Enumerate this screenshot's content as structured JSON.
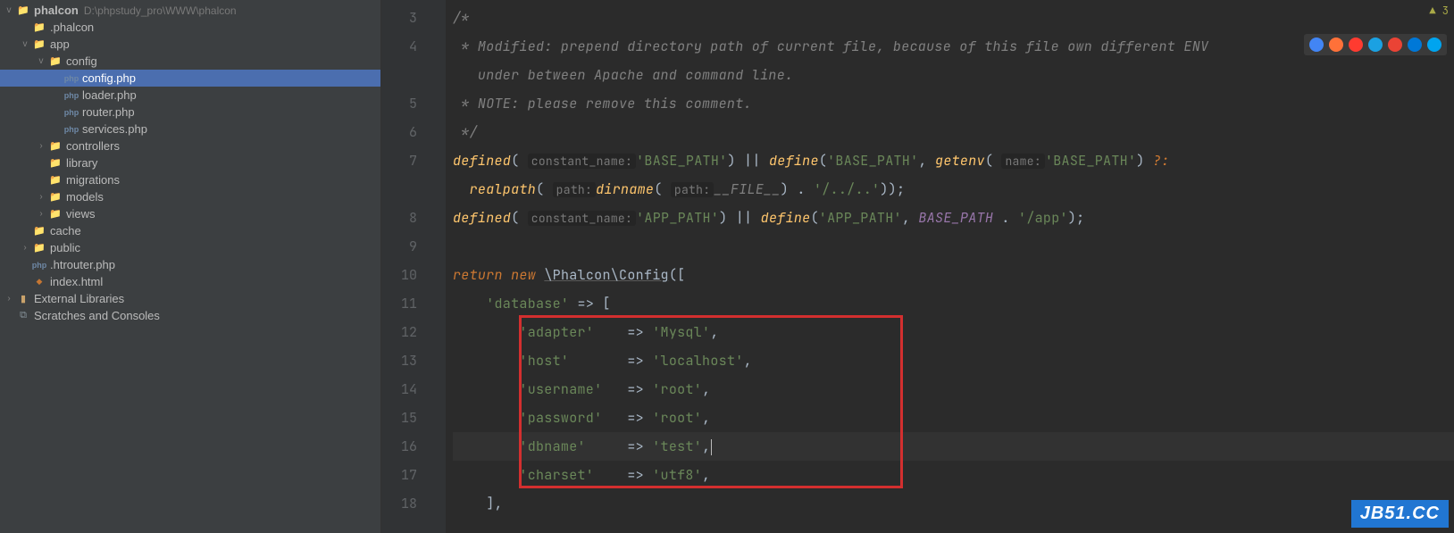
{
  "sidebar": {
    "project": {
      "name": "phalcon",
      "path": "D:\\phpstudy_pro\\WWW\\phalcon"
    },
    "items": [
      {
        "label": ".phalcon",
        "type": "folder",
        "indent": 1,
        "chev": ""
      },
      {
        "label": "app",
        "type": "folder",
        "indent": 1,
        "chev": "v"
      },
      {
        "label": "config",
        "type": "folder",
        "indent": 2,
        "chev": "v"
      },
      {
        "label": "config.php",
        "type": "php",
        "indent": 3,
        "selected": true
      },
      {
        "label": "loader.php",
        "type": "php",
        "indent": 3
      },
      {
        "label": "router.php",
        "type": "php",
        "indent": 3
      },
      {
        "label": "services.php",
        "type": "php",
        "indent": 3
      },
      {
        "label": "controllers",
        "type": "folder",
        "indent": 2,
        "chev": ">"
      },
      {
        "label": "library",
        "type": "folder",
        "indent": 2,
        "chev": ""
      },
      {
        "label": "migrations",
        "type": "folder",
        "indent": 2,
        "chev": ""
      },
      {
        "label": "models",
        "type": "folder",
        "indent": 2,
        "chev": ">"
      },
      {
        "label": "views",
        "type": "folder",
        "indent": 2,
        "chev": ">"
      },
      {
        "label": "cache",
        "type": "folder",
        "indent": 1,
        "chev": ""
      },
      {
        "label": "public",
        "type": "folder",
        "indent": 1,
        "chev": ">"
      },
      {
        "label": ".htrouter.php",
        "type": "php",
        "indent": 1
      },
      {
        "label": "index.html",
        "type": "html",
        "indent": 1
      }
    ],
    "external": "External Libraries",
    "scratches": "Scratches and Consoles"
  },
  "editor": {
    "lineStart": 3,
    "lineEnd": 18,
    "currentLine": 16,
    "warnCount": "3",
    "code": {
      "l3": "/*",
      "l4a": " * Modified: prepend directory path of current file, because of this file own different ENV",
      "l4b": "   under between Apache and command line.",
      "l5": " * NOTE: please remove this comment.",
      "l6": " */",
      "l7": {
        "kw": "defined",
        "hint1": "constant_name:",
        "s1": "'BASE_PATH'",
        "op": "||",
        "kw2": "define",
        "s2": "'BASE_PATH'",
        "fn": "getenv",
        "hint2": "name:",
        "s3": "'BASE_PATH'",
        "q": "?:"
      },
      "l7b": {
        "fn": "realpath",
        "hint1": "path:",
        "fn2": "dirname",
        "hint2": "path:",
        "file": "__FILE__",
        "s": "'/../..'"
      },
      "l8": {
        "kw": "defined",
        "hint1": "constant_name:",
        "s1": "'APP_PATH'",
        "op": "||",
        "kw2": "define",
        "s2": "'APP_PATH'",
        "const": "BASE_PATH",
        "s3": "'/app'"
      },
      "l10": {
        "kw": "return",
        "kw2": "new",
        "ns": "\\Phalcon\\",
        "cls": "Config"
      },
      "l11": {
        "k": "'database'",
        "arrow": "=>"
      },
      "l12": {
        "k": "'adapter'",
        "v": "'Mysql'"
      },
      "l13": {
        "k": "'host'",
        "v": "'localhost'"
      },
      "l14": {
        "k": "'username'",
        "v": "'root'"
      },
      "l15": {
        "k": "'password'",
        "v": "'root'"
      },
      "l16": {
        "k": "'dbname'",
        "v": "'test'"
      },
      "l17": {
        "k": "'charset'",
        "v": "'utf8'"
      }
    }
  },
  "watermark": "JB51.CC",
  "browserColors": [
    "#4285f4",
    "#ff7139",
    "#ff3b30",
    "#1ba1e2",
    "#ea4335",
    "#0078d7",
    "#00a4ef"
  ]
}
